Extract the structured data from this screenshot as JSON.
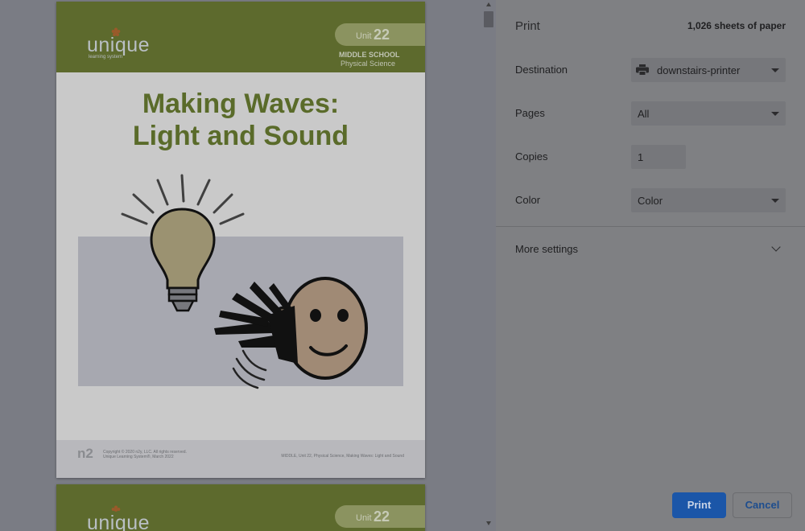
{
  "document": {
    "logo_text": "unique",
    "logo_sub": "learning system",
    "unit_word": "Unit",
    "unit_number": "22",
    "level": "MIDDLE SCHOOL",
    "subject": "Physical Science",
    "title_line1": "Making Waves:",
    "title_line2": "Light and Sound",
    "footer_logo": "n2",
    "copyright_line1": "Copyright © 2020 n2y, LLC. All rights reserved.",
    "copyright_line2": "Unique Learning System®, March 2022",
    "footer_right": "MIDDLE, Unit 22, Physical Science, Making Waves: Light and Sound"
  },
  "panel": {
    "title": "Print",
    "sheets": "1,026 sheets of paper",
    "destination_label": "Destination",
    "destination_value": "downstairs-printer",
    "pages_label": "Pages",
    "pages_value": "All",
    "copies_label": "Copies",
    "copies_value": "1",
    "color_label": "Color",
    "color_value": "Color",
    "more_settings": "More settings",
    "print_button": "Print",
    "cancel_button": "Cancel"
  },
  "colors": {
    "accent": "#1b56a8",
    "brand_green": "#5d6a2d"
  },
  "icons": [
    "printer-icon",
    "chevron-down-icon",
    "lightbulb-icon",
    "face-icon"
  ]
}
